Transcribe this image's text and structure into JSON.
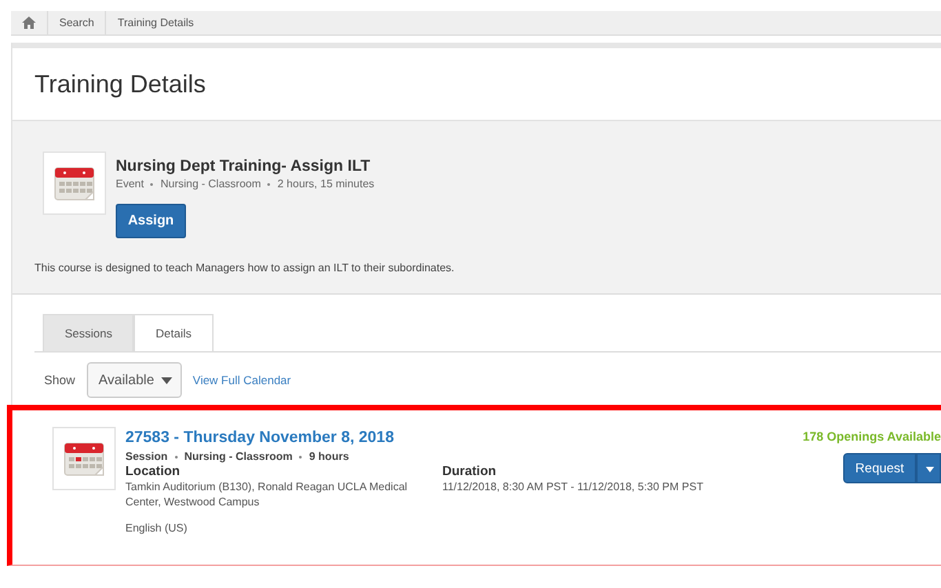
{
  "breadcrumb": [
    {
      "kind": "home"
    },
    {
      "kind": "link",
      "label": "Search"
    },
    {
      "kind": "current",
      "label": "Training Details"
    }
  ],
  "page_title": "Training Details",
  "course": {
    "title": "Nursing Dept Training- Assign ILT",
    "meta": [
      "Event",
      "Nursing - Classroom",
      "2 hours, 15 minutes"
    ],
    "button": "Assign",
    "description": "This course is designed to teach Managers how to assign an ILT to their subordinates."
  },
  "tabs": [
    {
      "label": "Sessions",
      "selected": true
    },
    {
      "label": "Details",
      "selected": false
    }
  ],
  "filter": {
    "label": "Show",
    "value": "Available",
    "link": "View Full Calendar"
  },
  "session": {
    "highlighted": true,
    "title": "27583 - Thursday November 8, 2018",
    "meta": [
      "Session",
      "Nursing - Classroom",
      "9 hours"
    ],
    "location_label": "Location",
    "location": "Tamkin Auditorium (B130), Ronald Reagan UCLA Medical Center, Westwood Campus",
    "language": "English (US)",
    "duration_label": "Duration",
    "duration": "11/12/2018, 8:30 AM PST - 11/12/2018, 5:30 PM PST",
    "openings": "178 Openings Available",
    "button": "Request"
  }
}
